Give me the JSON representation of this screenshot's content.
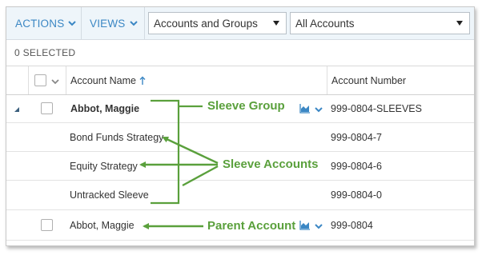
{
  "toolbar": {
    "actions_label": "ACTIONS",
    "views_label": "VIEWS",
    "filter_select_value": "Accounts and Groups",
    "accounts_select_value": "All Accounts"
  },
  "selection": {
    "selected_text": "0 SELECTED"
  },
  "table": {
    "headers": {
      "account_name": "Account Name",
      "account_number": "Account Number"
    },
    "rows": [
      {
        "name": "Abbot, Maggie",
        "number": "999-0804-SLEEVES"
      },
      {
        "name": "Bond Funds Strategy",
        "number": "999-0804-7"
      },
      {
        "name": "Equity Strategy",
        "number": "999-0804-6"
      },
      {
        "name": "Untracked Sleeve",
        "number": "999-0804-0"
      },
      {
        "name": "Abbot, Maggie",
        "number": "999-0804"
      }
    ]
  },
  "annotations": {
    "sleeve_group": "Sleeve Group",
    "sleeve_accounts": "Sleeve Accounts",
    "parent_account": "Parent Account"
  },
  "colors": {
    "accent_blue": "#3b87c4",
    "annotation_green": "#5aa03c",
    "toolbar_bg": "#eef5fa"
  },
  "icons": [
    "chevron-down-icon",
    "dropdown-caret-icon",
    "sort-ascending-icon",
    "expand-triangle-icon",
    "chart-icon",
    "arrow-left-icon"
  ]
}
